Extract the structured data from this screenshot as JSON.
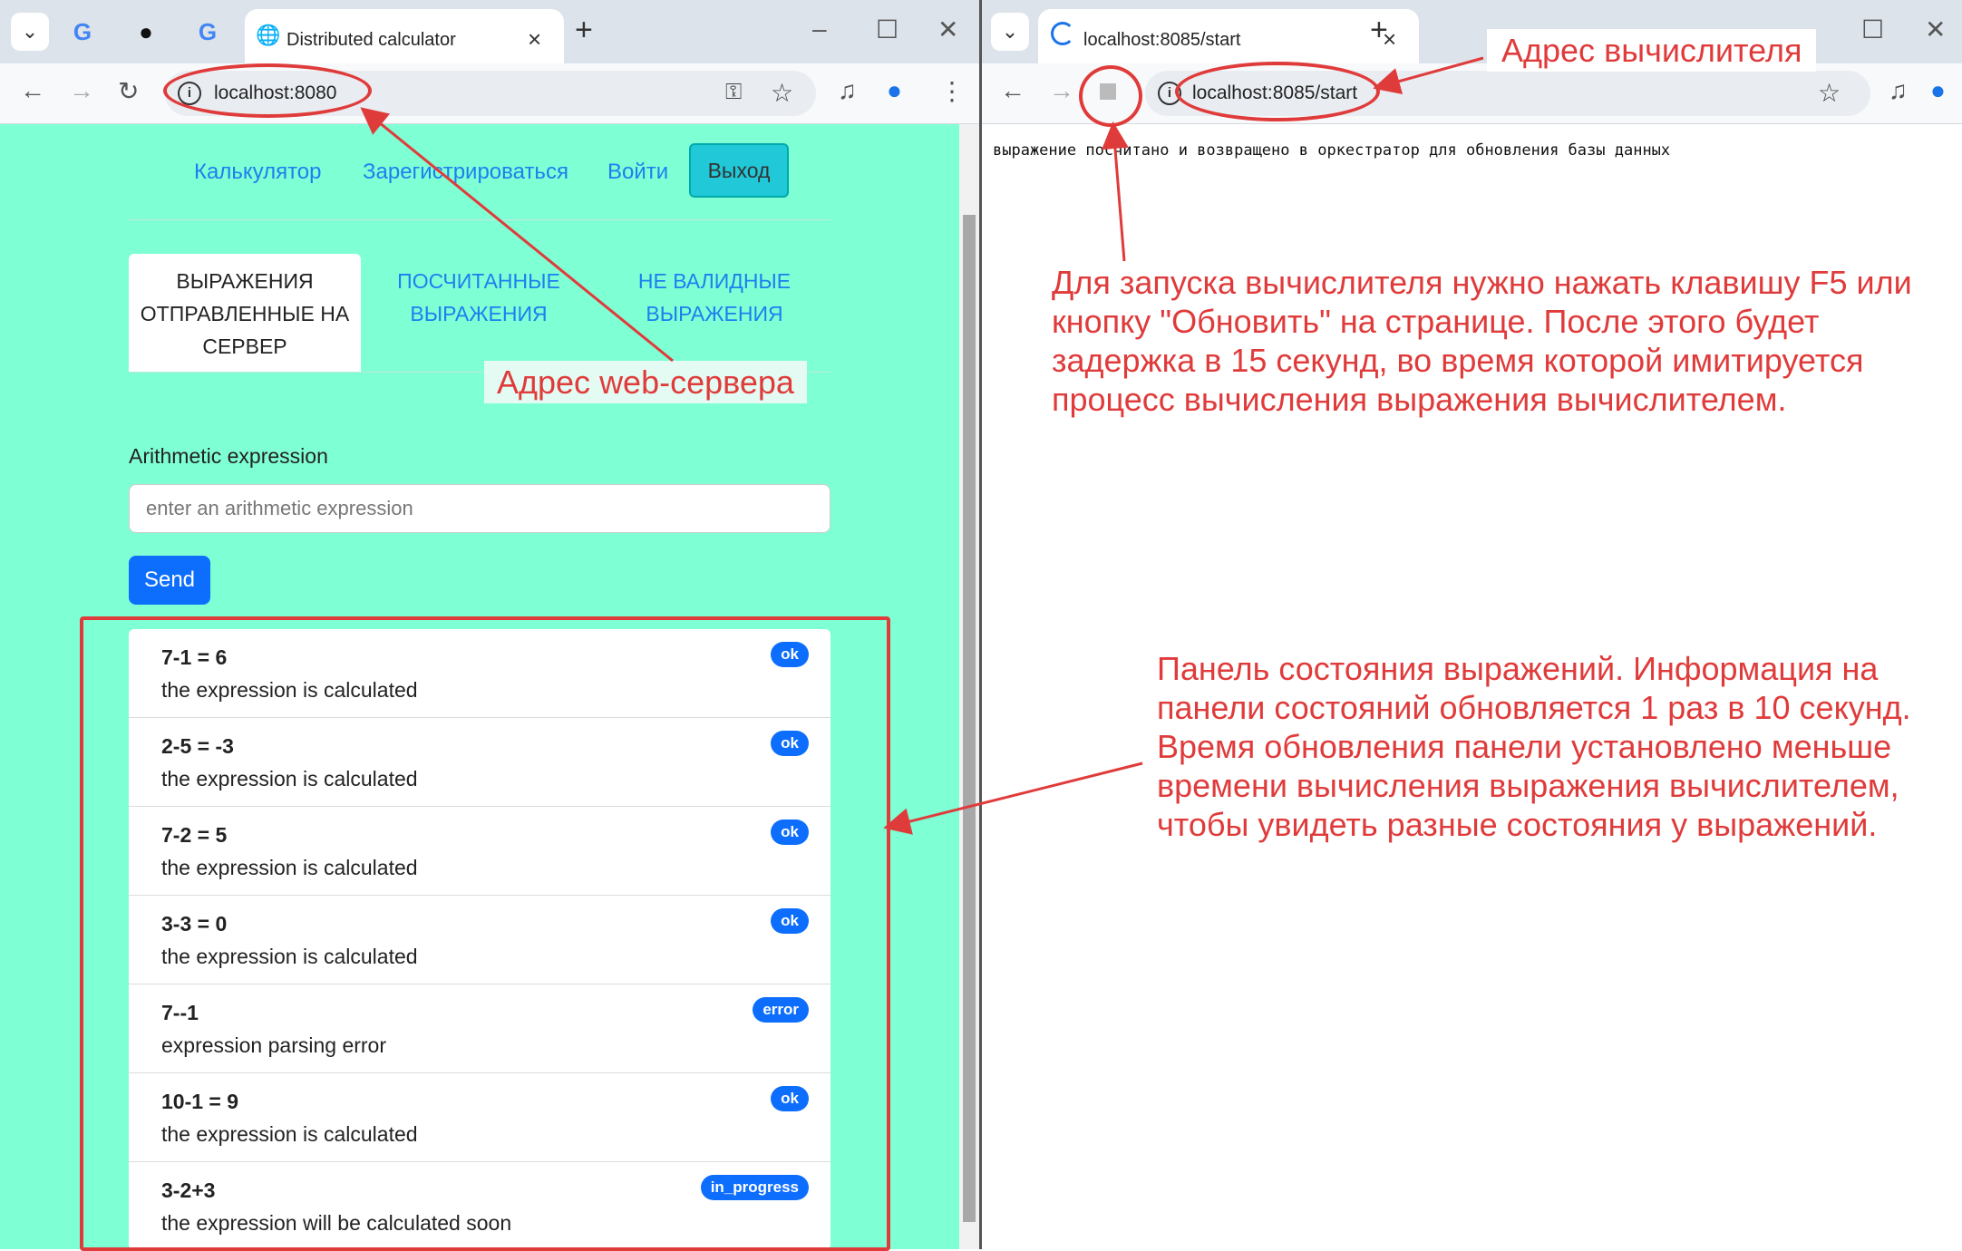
{
  "left_browser": {
    "tab_title": "Distributed calculator",
    "url": "localhost:8080",
    "nav": {
      "calculator": "Калькулятор",
      "register": "Зарегистрироваться",
      "login": "Войти",
      "logout": "Выход"
    },
    "content_tabs": [
      "ВЫРАЖЕНИЯ ОТПРАВЛЕННЫЕ НА СЕРВЕР",
      "ПОСЧИТАННЫЕ ВЫРАЖЕНИЯ",
      "НЕ ВАЛИДНЫЕ ВЫРАЖЕНИЯ"
    ],
    "form": {
      "label": "Arithmetic expression",
      "placeholder": "enter an arithmetic expression",
      "send": "Send"
    },
    "expressions": [
      {
        "expr": "7-1 = 6",
        "message": "the expression is calculated",
        "status": "ok"
      },
      {
        "expr": "2-5 = -3",
        "message": "the expression is calculated",
        "status": "ok"
      },
      {
        "expr": "7-2 = 5",
        "message": "the expression is calculated",
        "status": "ok"
      },
      {
        "expr": "3-3 = 0",
        "message": "the expression is calculated",
        "status": "ok"
      },
      {
        "expr": "7--1",
        "message": "expression parsing error",
        "status": "error"
      },
      {
        "expr": "10-1 = 9",
        "message": "the expression is calculated",
        "status": "ok"
      },
      {
        "expr": "3-2+3",
        "message": "the expression will be calculated soon",
        "status": "in_progress"
      }
    ]
  },
  "right_browser": {
    "tab_title": "localhost:8085/start",
    "url": "localhost:8085/start",
    "page_text": "выражение посчитано и возвращено в оркестратор для обновления базы данных"
  },
  "annotations": {
    "web_server": "Адрес web-сервера",
    "calculator": "Адрес вычислителя",
    "f5_hint": "Для  запуска  вычислителя  нужно нажать клавишу F5 или кнопку \"Обновить\" на странице. После этого будет задержка в 15 секунд,  во  время которой имитируется процесс вычисления выражения вычислителем.",
    "panel_hint": "Панель состояния выражений. Информация на панели состояний обновляется 1 раз в 10 секунд. Время обновления панели установлено меньше  времени  вычисления  выражения вычислителем, чтобы увидеть разные состояния у выражений."
  },
  "colors": {
    "annotation": "#e03b3b",
    "page_bg": "#7fffd4",
    "badge": "#0d6efd"
  }
}
